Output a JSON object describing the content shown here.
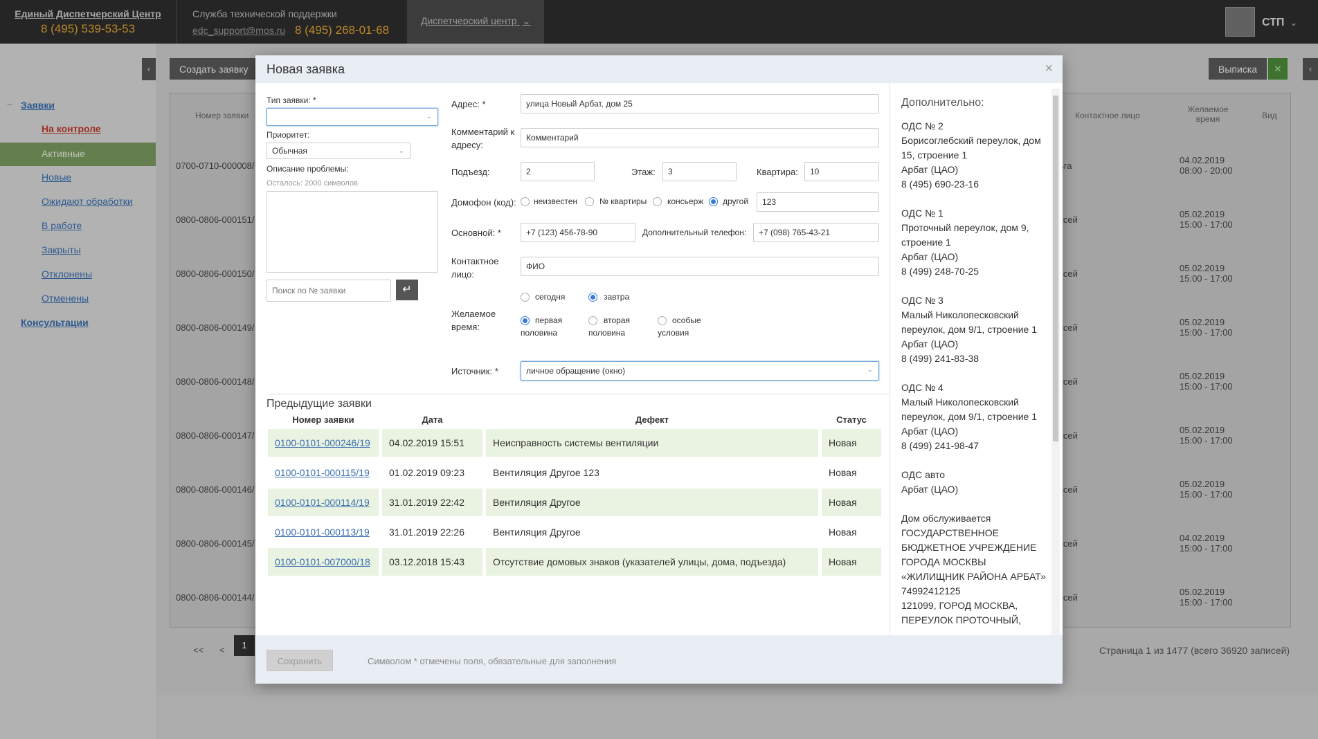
{
  "topbar": {
    "brand_title": "Единый Диспетчерский Центр",
    "brand_phone": "8 (495) 539-53-53",
    "support_title": "Служба технической поддержки",
    "support_email": "edc_support@mos.ru",
    "support_phone": "8 (495) 268-01-68",
    "dispatch_label": "Диспетчерский центр",
    "user_name": "СТП"
  },
  "sidebar": {
    "section_requests": "Заявки",
    "items": [
      "На контроле",
      "Активные",
      "Новые",
      "Ожидают обработки",
      "В работе",
      "Закрыты",
      "Отклонены",
      "Отменены"
    ],
    "section_consult": "Консультации"
  },
  "background": {
    "create_button": "Создать заявку",
    "statement_button": "Выписка",
    "col_number": "Номер заявки",
    "col_contact": "Контактное лицо",
    "col_time": "Желаемое время",
    "col_type": "Вид",
    "rows": [
      {
        "num": "0700-0710-000008/",
        "contact": "ьга",
        "date": "04.02.2019",
        "time": "08:00 - 20:00"
      },
      {
        "num": "0800-0806-000151/",
        "contact": "ксей",
        "date": "05.02.2019",
        "time": "15:00 - 17:00"
      },
      {
        "num": "0800-0806-000150/",
        "contact": "ксей",
        "date": "05.02.2019",
        "time": "15:00 - 17:00"
      },
      {
        "num": "0800-0806-000149/",
        "contact": "ксей",
        "date": "05.02.2019",
        "time": "15:00 - 17:00"
      },
      {
        "num": "0800-0806-000148/",
        "contact": "ксей",
        "date": "05.02.2019",
        "time": "15:00 - 17:00"
      },
      {
        "num": "0800-0806-000147/",
        "contact": "ксей",
        "date": "05.02.2019",
        "time": "15:00 - 17:00"
      },
      {
        "num": "0800-0806-000146/",
        "contact": "ксей",
        "date": "05.02.2019",
        "time": "15:00 - 17:00"
      },
      {
        "num": "0800-0806-000145/",
        "contact": "ксей",
        "date": "04.02.2019",
        "time": "15:00 - 17:00"
      },
      {
        "num": "0800-0806-000144/",
        "contact": "ксей",
        "date": "05.02.2019",
        "time": "15:00 - 17:00"
      }
    ],
    "pager_first": "<<",
    "pager_prev": "<",
    "pager_current": "1",
    "pager_info": "Страница 1 из 1477 (всего 36920 записей)"
  },
  "modal": {
    "title": "Новая заявка",
    "close": "×",
    "type_label": "Тип заявки: *",
    "priority_label": "Приоритет:",
    "priority_value": "Обычная",
    "problem_label": "Описание проблемы:",
    "remaining": "Осталось: 2000 символов",
    "search_placeholder": "Поиск по № заявки",
    "enter_icon": "↵",
    "address_label": "Адрес: *",
    "address_value": "улица Новый Арбат, дом 25",
    "addr_comment_label": "Комментарий к адресу:",
    "addr_comment_value": "Комментарий",
    "entrance_label": "Подъезд:",
    "entrance_value": "2",
    "floor_label": "Этаж:",
    "floor_value": "3",
    "apt_label": "Квартира:",
    "apt_value": "10",
    "intercom_label": "Домофон (код):",
    "intercom_options": [
      "неизвестен",
      "№ квартиры",
      "консьерж",
      "другой"
    ],
    "intercom_selected": 3,
    "intercom_value": "123",
    "main_phone_label": "Основной: *",
    "main_phone_value": "+7 (123) 456-78-90",
    "extra_phone_label": "Дополнительный телефон:",
    "extra_phone_value": "+7 (098) 765-43-21",
    "contact_label": "Контактное лицо:",
    "contact_value": "ФИО",
    "time_label": "Желаемое время:",
    "day_options": [
      "сегодня",
      "завтра"
    ],
    "day_selected": 1,
    "half_options": [
      "первая половина",
      "вторая половина",
      "особые условия"
    ],
    "half_selected": 0,
    "source_label": "Источник: *",
    "source_value": "личное обращение (окно)",
    "prev_title": "Предыдущие заявки",
    "prev_headers": [
      "Номер заявки",
      "Дата",
      "Дефект",
      "Статус"
    ],
    "prev_rows": [
      {
        "num": "0100-0101-000246/19",
        "date": "04.02.2019 15:51",
        "defect": "Неисправность системы вентиляции",
        "status": "Новая"
      },
      {
        "num": "0100-0101-000115/19",
        "date": "01.02.2019 09:23",
        "defect": "Вентиляция Другое 123",
        "status": "Новая"
      },
      {
        "num": "0100-0101-000114/19",
        "date": "31.01.2019 22:42",
        "defect": "Вентиляция Другое",
        "status": "Новая"
      },
      {
        "num": "0100-0101-000113/19",
        "date": "31.01.2019 22:26",
        "defect": "Вентиляция Другое",
        "status": "Новая"
      },
      {
        "num": "0100-0101-007000/18",
        "date": "03.12.2018 15:43",
        "defect": "Отсутствие домовых знаков (указателей улицы, дома, подъезда)",
        "status": "Новая"
      }
    ],
    "save_button": "Сохранить",
    "footer_note": "Символом * отмечены поля, обязательные для заполнения",
    "extra_title": "Дополнительно:",
    "extra_blocks": [
      "ОДС № 2\nБорисоглебский переулок, дом 15, строение 1\nАрбат (ЦАО)\n8 (495) 690-23-16",
      "ОДС № 1\nПроточный переулок, дом 9, строение 1\nАрбат (ЦАО)\n8 (499) 248-70-25",
      "ОДС № 3\nМалый Николопесковский переулок, дом 9/1, строение 1\nАрбат (ЦАО)\n8 (499) 241-83-38",
      "ОДС № 4\nМалый Николопесковский переулок, дом 9/1, строение 1\nАрбат (ЦАО)\n8 (499) 241-98-47",
      "ОДС авто\nАрбат (ЦАО)",
      "Дом обслуживается ГОСУДАРСТВЕННОЕ БЮДЖЕТНОЕ УЧРЕЖДЕНИЕ ГОРОДА МОСКВЫ «ЖИЛИЩНИК РАЙОНА АРБАТ»\n74992412125\n121099, ГОРОД МОСКВА, ПЕРЕУЛОК ПРОТОЧНЫЙ,"
    ]
  }
}
